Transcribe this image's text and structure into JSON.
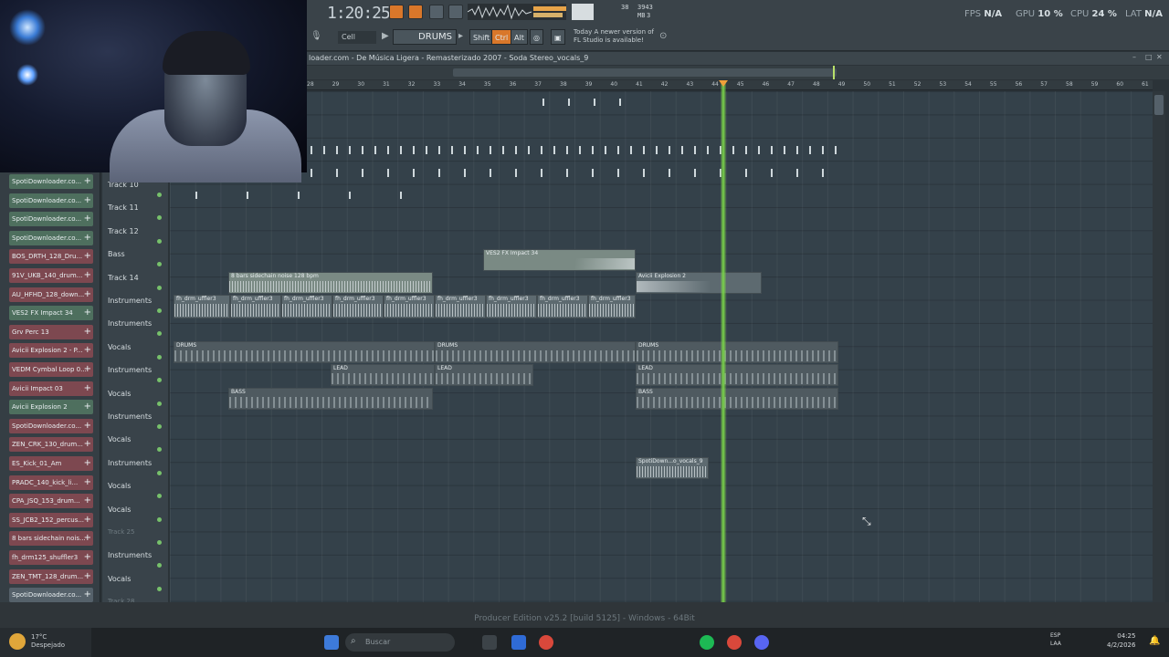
{
  "app": {
    "time": "1:20:25",
    "pattern_name": "DRUMS",
    "snap": "Cell",
    "keys": {
      "shift": "Shift",
      "ctrl": "Ctrl",
      "alt": "Alt"
    },
    "hint_line1": "Today  A newer version of",
    "hint_line2": "FL Studio is available!",
    "mem_top": "38",
    "mem_size": "3943 MB",
    "mem_bottom": "3",
    "fps_label": "FPS",
    "fps_value": "N/A",
    "gpu_label": "GPU",
    "gpu_value": "10 %",
    "cpu_label": "CPU",
    "cpu_value": "24 %",
    "lat_label": "LAT",
    "lat_value": "N/A"
  },
  "playlist": {
    "title": "loader.com - De Música Ligera - Remasterizado 2007 - Soda Stereo_vocals_9",
    "bars": [
      "28",
      "29",
      "30",
      "31",
      "32",
      "33",
      "34",
      "35",
      "36",
      "37",
      "38",
      "39",
      "40",
      "41",
      "42",
      "43",
      "44",
      "45",
      "46",
      "47",
      "48",
      "49",
      "50",
      "51",
      "52",
      "53",
      "54",
      "55",
      "56",
      "57",
      "58",
      "59",
      "60",
      "61"
    ]
  },
  "channels": [
    {
      "name": "SpotiDownloader.co...",
      "color": "green"
    },
    {
      "name": "SpotiDownloader.co...",
      "color": "green"
    },
    {
      "name": "SpotiDownloader.co...",
      "color": "green"
    },
    {
      "name": "SpotiDownloader.co...",
      "color": "green"
    },
    {
      "name": "BOS_DRTH_128_Dru...",
      "color": "red"
    },
    {
      "name": "91V_UKB_140_drum...",
      "color": "red"
    },
    {
      "name": "AU_HFHD_128_down...",
      "color": "red"
    },
    {
      "name": "VES2 FX Impact 34",
      "color": "green"
    },
    {
      "name": "Grv Perc 13",
      "color": "red"
    },
    {
      "name": "Avicii Explosion 2 - P...",
      "color": "red"
    },
    {
      "name": "VEDM Cymbal Loop 0...",
      "color": "red"
    },
    {
      "name": "Avicii Impact 03",
      "color": "red"
    },
    {
      "name": "Avicii Explosion 2",
      "color": "green"
    },
    {
      "name": "SpotiDownloader.co...",
      "color": "red"
    },
    {
      "name": "ZEN_CRK_130_drum...",
      "color": "red"
    },
    {
      "name": "ES_Kick_01_Am",
      "color": "red"
    },
    {
      "name": "PRADC_140_kick_li...",
      "color": "red"
    },
    {
      "name": "CPA_JSQ_153_drum...",
      "color": "red"
    },
    {
      "name": "SS_JCB2_152_percus...",
      "color": "red"
    },
    {
      "name": "8 bars sidechain nois...",
      "color": "red"
    },
    {
      "name": "fh_drm125_shuffler3",
      "color": "red"
    },
    {
      "name": "ZEN_TMT_128_drum...",
      "color": "red"
    },
    {
      "name": "SpotiDownloader.co...",
      "color": "grey"
    }
  ],
  "tracks": [
    "Track 10",
    "Track 11",
    "Track 12",
    "Bass",
    "Track 14",
    "Instruments",
    "Instruments",
    "Vocals",
    "Instruments",
    "Vocals",
    "Instruments",
    "Vocals",
    "Instruments",
    "Vocals",
    "Vocals",
    "Track 25",
    "Instruments",
    "Vocals",
    "Track 28"
  ],
  "clips": {
    "impact": "VES2 FX Impact 34",
    "sidechain": "8 bars sidechain noise 128 bpm",
    "explosion": "Avicii Explosion 2",
    "shuffler": "fh_drm_uffler3",
    "drums": "DRUMS",
    "lead": "LEAD",
    "bass": "BASS",
    "vocals": "SpotiDown...o_vocals_9"
  },
  "footer": {
    "text": "Producer Edition v25.2 [build 5125] - Windows - 64Bit"
  },
  "taskbar": {
    "temp": "17°C",
    "weather": "Despejado",
    "search": "Buscar",
    "lang1": "ESP",
    "lang2": "LAA",
    "time": "04:25",
    "date": "4/2/2026"
  }
}
